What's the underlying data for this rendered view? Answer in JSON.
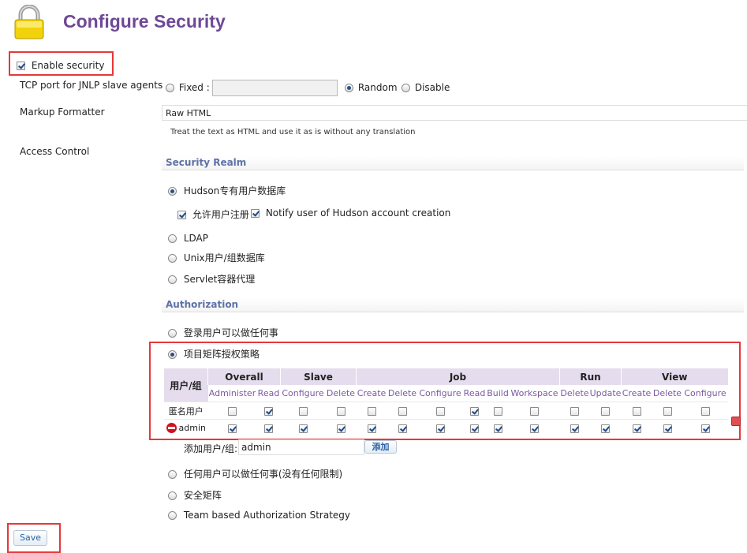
{
  "header": {
    "title": "Configure Security"
  },
  "enable_security": {
    "label": "Enable security",
    "checked": true
  },
  "tcp_port": {
    "label": "TCP port for JNLP slave agents",
    "fixed_label": "Fixed :",
    "fixed_value": "",
    "random_label": "Random",
    "disable_label": "Disable",
    "selected": "random"
  },
  "markup_formatter": {
    "label": "Markup Formatter",
    "value": "Raw HTML",
    "description": "Treat the text as HTML and use it as is without any translation"
  },
  "access_control": {
    "label": "Access Control"
  },
  "security_realm": {
    "heading": "Security Realm",
    "options": [
      "Hudson专有用户数据库",
      "LDAP",
      "Unix用户/组数据库",
      "Servlet容器代理"
    ],
    "selected_index": 0,
    "allow_signup_label": "允许用户注册",
    "notify_label": "Notify user of Hudson account creation"
  },
  "authorization": {
    "heading": "Authorization",
    "options": [
      "登录用户可以做任何事",
      "项目矩阵授权策略",
      "任何用户可以做任何事(没有任何限制)",
      "安全矩阵",
      "Team based Authorization Strategy"
    ],
    "selected_index": 1
  },
  "matrix": {
    "user_group_header": "用户/组",
    "groups": [
      {
        "name": "Overall",
        "perms": [
          "Administer",
          "Read"
        ]
      },
      {
        "name": "Slave",
        "perms": [
          "Configure",
          "Delete"
        ]
      },
      {
        "name": "Job",
        "perms": [
          "Create",
          "Delete",
          "Configure",
          "Read",
          "Build",
          "Workspace"
        ]
      },
      {
        "name": "Run",
        "perms": [
          "Delete",
          "Update"
        ]
      },
      {
        "name": "View",
        "perms": [
          "Create",
          "Delete",
          "Configure"
        ]
      }
    ],
    "rows": [
      {
        "name": "匿名用户",
        "removable": false,
        "checks": [
          false,
          true,
          false,
          false,
          false,
          false,
          false,
          true,
          false,
          false,
          false,
          false,
          false,
          false,
          false
        ]
      },
      {
        "name": "admin",
        "removable": true,
        "checks": [
          true,
          true,
          true,
          true,
          true,
          true,
          true,
          true,
          true,
          true,
          true,
          true,
          true,
          true,
          true
        ]
      }
    ],
    "add_label": "添加用户/组:",
    "add_value": "admin",
    "add_button": "添加"
  },
  "save_button": "Save",
  "colors": {
    "title": "#6f4896",
    "section": "#5d72a8",
    "highlight": "#e5383b",
    "matrix_header": "#e5dced"
  }
}
